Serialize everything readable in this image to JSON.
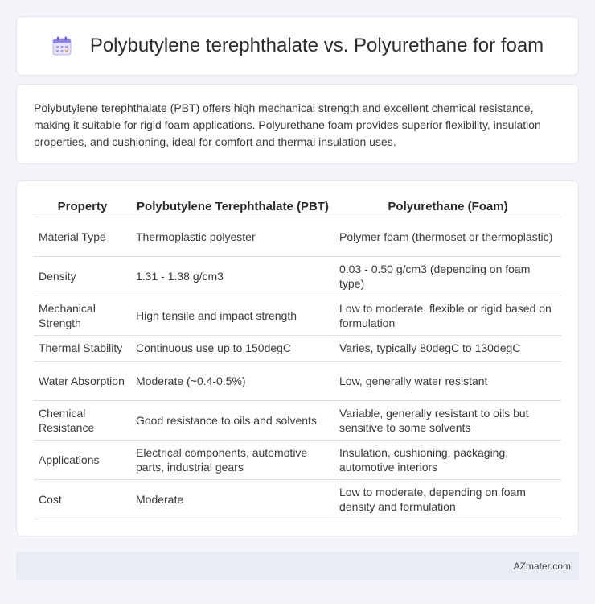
{
  "header": {
    "icon": "calendar-doc-icon",
    "title": "Polybutylene terephthalate vs. Polyurethane for foam"
  },
  "intro": {
    "text": "Polybutylene terephthalate (PBT) offers high mechanical strength and excellent chemical resistance, making it suitable for rigid foam applications. Polyurethane foam provides superior flexibility, insulation properties, and cushioning, ideal for comfort and thermal insulation uses."
  },
  "table": {
    "headers": [
      "Property",
      "Polybutylene Terephthalate (PBT)",
      "Polyurethane (Foam)"
    ],
    "rows": [
      [
        "Material Type",
        "Thermoplastic polyester",
        "Polymer foam (thermoset or thermoplastic)"
      ],
      [
        "Density",
        "1.31 - 1.38 g/cm3",
        "0.03 - 0.50 g/cm3 (depending on foam type)"
      ],
      [
        "Mechanical Strength",
        "High tensile and impact strength",
        "Low to moderate, flexible or rigid based on formulation"
      ],
      [
        "Thermal Stability",
        "Continuous use up to 150degC",
        "Varies, typically 80degC to 130degC"
      ],
      [
        "Water Absorption",
        "Moderate (~0.4-0.5%)",
        "Low, generally water resistant"
      ],
      [
        "Chemical Resistance",
        "Good resistance to oils and solvents",
        "Variable, generally resistant to oils but sensitive to some solvents"
      ],
      [
        "Applications",
        "Electrical components, automotive parts, industrial gears",
        "Insulation, cushioning, packaging, automotive interiors"
      ],
      [
        "Cost",
        "Moderate",
        "Low to moderate, depending on foam density and formulation"
      ]
    ]
  },
  "footer": {
    "brand": "AZmater.com"
  }
}
